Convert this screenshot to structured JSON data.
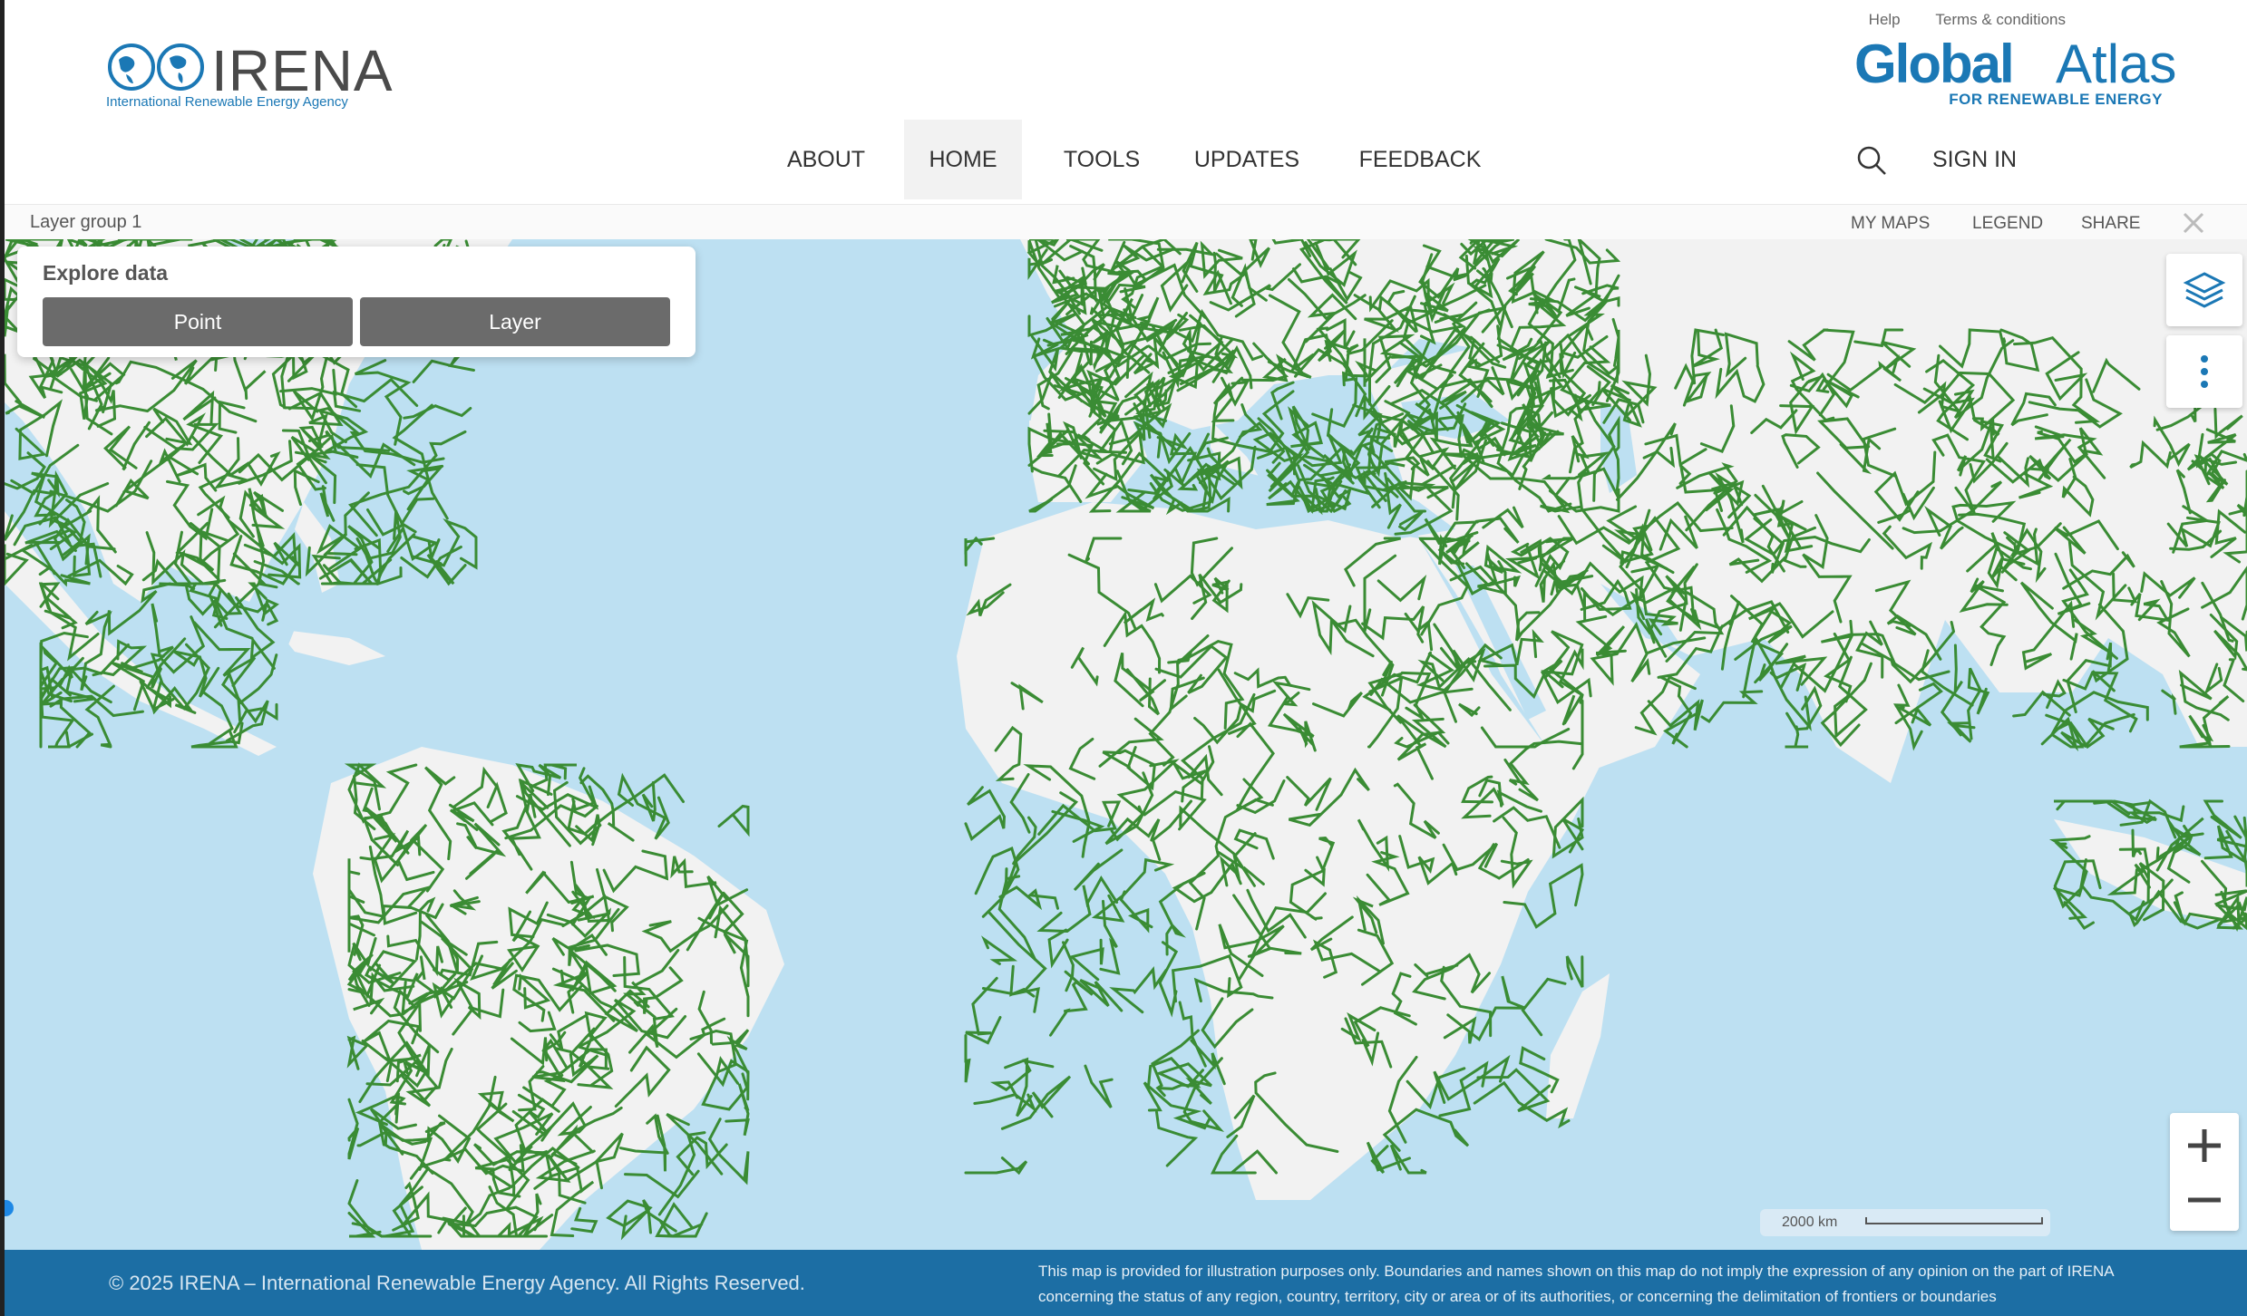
{
  "header": {
    "irena_logo_text": "IRENA",
    "irena_logo_subtitle": "International Renewable Energy Agency",
    "top_links": [
      "Help",
      "Terms & conditions"
    ],
    "global_atlas_logo": {
      "bold": "Global",
      "regular": "Atlas",
      "subtitle": "FOR RENEWABLE ENERGY"
    },
    "nav": [
      "ABOUT",
      "HOME",
      "TOOLS",
      "UPDATES",
      "FEEDBACK"
    ],
    "active_nav": "HOME",
    "sign_in": "SIGN IN",
    "search_icon": "search-icon"
  },
  "toolbar": {
    "layer_group": "Layer group 1",
    "links": [
      "MY MAPS",
      "LEGEND",
      "SHARE"
    ],
    "close_icon": "close-icon"
  },
  "explore": {
    "title": "Explore data",
    "buttons": [
      "Point",
      "Layer"
    ]
  },
  "map": {
    "side_buttons": [
      "layers-icon",
      "more-vertical-icon"
    ],
    "zoom_in": "+",
    "zoom_out": "−",
    "scale_label": "2000 km",
    "colors": {
      "water": "#bde0f2",
      "land": "#f2f2f2",
      "lines": "#3a8c34"
    }
  },
  "footer": {
    "copyright": "© 2025 IRENA – International Renewable Energy Agency. All Rights Reserved.",
    "disclaimer_line1": "This map is provided for illustration purposes only. Boundaries and names shown on this map do not imply the expression of any opinion on the part of IRENA",
    "disclaimer_line2": "concerning the status of any region, country, territory, city or area or of its authorities, or concerning the delimitation of frontiers or boundaries"
  }
}
